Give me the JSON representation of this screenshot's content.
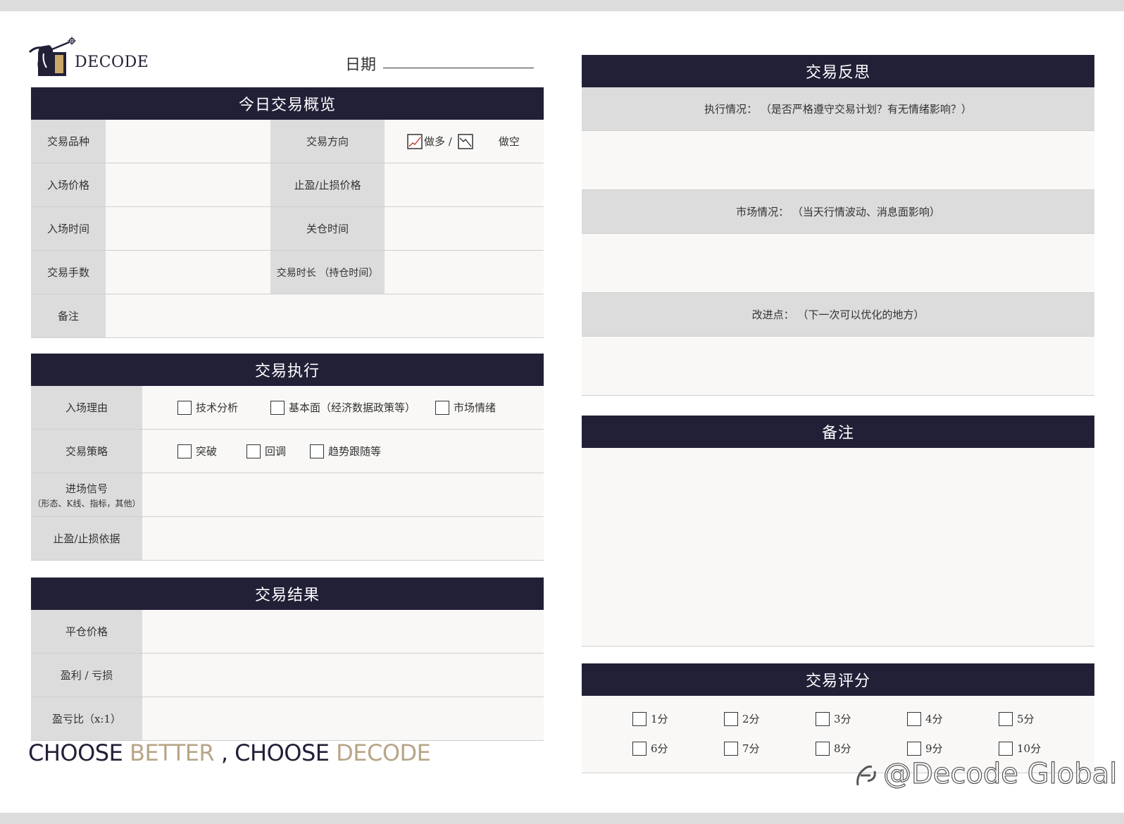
{
  "brand": {
    "name": "DECODE"
  },
  "date": {
    "label": "日期"
  },
  "overview": {
    "title": "今日交易概览",
    "rows": [
      {
        "left_label": "交易品种",
        "right_label": "交易方向"
      },
      {
        "left_label": "入场价格",
        "right_label": "止盈/止损价格"
      },
      {
        "left_label": "入场时间",
        "right_label": "关仓时间"
      },
      {
        "left_label": "交易手数",
        "right_label": "交易时长 （持仓时间）"
      },
      {
        "left_label": "备注"
      }
    ],
    "direction": {
      "long": "做多 /",
      "short": "做空"
    }
  },
  "execution": {
    "title": "交易执行",
    "rows": [
      {
        "label": "入场理由",
        "options": [
          "技术分析",
          "基本面（经济数据政策等）",
          "市场情绪"
        ]
      },
      {
        "label": "交易策略",
        "options": [
          "突破",
          "回调",
          "趋势跟随等"
        ]
      },
      {
        "label": "进场信号",
        "sublabel": "（形态、K线、指标，其他）"
      },
      {
        "label": "止盈/止损依据"
      }
    ]
  },
  "result": {
    "title": "交易结果",
    "rows": [
      {
        "label": "平仓价格"
      },
      {
        "label": "盈利 / 亏损"
      },
      {
        "label": "盈亏比（x:1）"
      }
    ]
  },
  "slogan": {
    "p1": "CHOOSE ",
    "p2": "BETTER",
    "p3": " , CHOOSE ",
    "p4": "DECODE"
  },
  "reflection": {
    "title": "交易反思",
    "items": [
      {
        "label": "执行情况：   （是否严格遵守交易计划？有无情绪影响？）"
      },
      {
        "label": "市场情况：   （当天行情波动、消息面影响）"
      },
      {
        "label": "改进点：   （下一次可以优化的地方）"
      }
    ]
  },
  "notes": {
    "title": "备注"
  },
  "rating": {
    "title": "交易评分",
    "options": [
      "1分",
      "2分",
      "3分",
      "4分",
      "5分",
      "6分",
      "7分",
      "8分",
      "9分",
      "10分"
    ]
  },
  "watermark": {
    "text": "@Decode Global"
  },
  "colors": {
    "navy": "#222037",
    "gold": "#b8a587",
    "label_gray": "#dcdcdc",
    "cell_bg": "#f9f8f7"
  }
}
